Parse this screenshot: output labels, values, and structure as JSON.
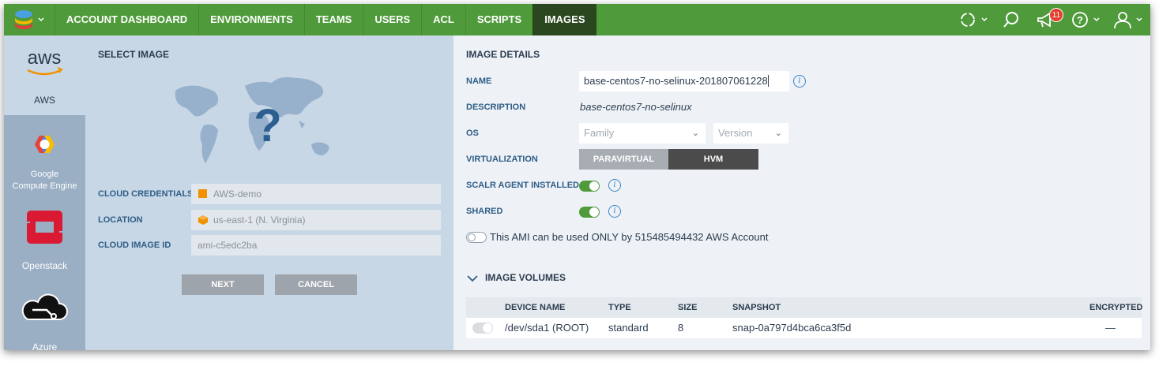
{
  "topbar": {
    "nav": [
      {
        "label": "ACCOUNT DASHBOARD",
        "active": false
      },
      {
        "label": "ENVIRONMENTS",
        "active": false
      },
      {
        "label": "TEAMS",
        "active": false
      },
      {
        "label": "USERS",
        "active": false
      },
      {
        "label": "ACL",
        "active": false
      },
      {
        "label": "SCRIPTS",
        "active": false
      },
      {
        "label": "IMAGES",
        "active": true
      }
    ],
    "notifications_count": "11",
    "icons": [
      "stack-logo-icon",
      "sync-icon",
      "search-icon",
      "megaphone-icon",
      "help-icon",
      "user-icon"
    ],
    "brand_color": "#4f9a3b"
  },
  "sidebar": {
    "items": [
      {
        "label": "AWS",
        "logo": "aws",
        "active": true
      },
      {
        "label": "Google\nCompute Engine",
        "active": false
      },
      {
        "label": "Openstack",
        "active": false
      },
      {
        "label": "Azure",
        "active": false
      }
    ]
  },
  "select_image": {
    "title": "SELECT IMAGE",
    "fields": {
      "cloud_credentials": {
        "label": "CLOUD CREDENTIALS",
        "value": "AWS-demo"
      },
      "location": {
        "label": "LOCATION",
        "value": "us-east-1 (N. Virginia)"
      },
      "cloud_image_id": {
        "label": "CLOUD IMAGE ID",
        "value": "ami-c5edc2ba"
      }
    },
    "buttons": {
      "next": "NEXT",
      "cancel": "CANCEL"
    }
  },
  "image_details": {
    "title": "IMAGE DETAILS",
    "name": {
      "label": "NAME",
      "value": "base-centos7-no-selinux-201807061228"
    },
    "description": {
      "label": "DESCRIPTION",
      "value": "base-centos7-no-selinux"
    },
    "os": {
      "label": "OS",
      "family_placeholder": "Family",
      "version_placeholder": "Version"
    },
    "virtualization": {
      "label": "VIRTUALIZATION",
      "options": [
        "PARAVIRTUAL",
        "HVM"
      ],
      "selected": "HVM"
    },
    "scalr_agent": {
      "label": "SCALR AGENT INSTALLED",
      "enabled": true
    },
    "shared": {
      "label": "SHARED",
      "enabled": true
    },
    "ami_only": {
      "text": "This AMI can be used ONLY by 515485494432 AWS Account",
      "enabled": false
    }
  },
  "image_volumes": {
    "title": "IMAGE VOLUMES",
    "columns": [
      "DEVICE NAME",
      "TYPE",
      "SIZE",
      "SNAPSHOT",
      "ENCRYPTED"
    ],
    "rows": [
      {
        "device": "/dev/sda1 (ROOT)",
        "type": "standard",
        "size": "8",
        "snapshot": "snap-0a797d4bca6ca3f5d",
        "encrypted": "—"
      }
    ]
  },
  "colors": {
    "accent_blue": "#3a86c9",
    "active_nav": "#2b471f",
    "panel_left": "#c7d7e6",
    "sidebar": "#9aaec4"
  }
}
